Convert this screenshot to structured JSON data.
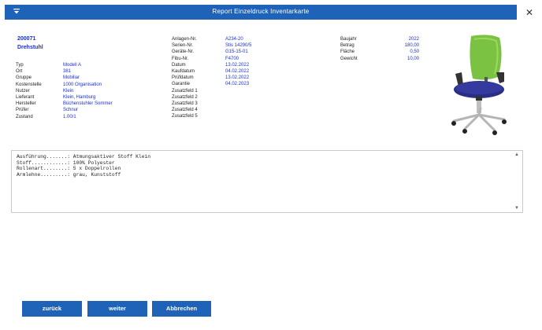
{
  "window": {
    "title": "Report Einzeldruck Inventarkarte",
    "menu_icon": "chevron-down-icon",
    "close_label": "✕"
  },
  "item": {
    "number": "200071",
    "name": "Drehstuhl"
  },
  "details_left": [
    {
      "label": "Typ",
      "value": "Modell A"
    },
    {
      "label": "Ort",
      "value": "381"
    },
    {
      "label": "Gruppe",
      "value": "Mobiliar"
    },
    {
      "label": "Kostenstelle",
      "value": "1000 Organisation"
    },
    {
      "label": "Nutzer",
      "value": "Klein"
    },
    {
      "label": "Lieferant",
      "value": "Klein, Hamburg"
    },
    {
      "label": "Hersteller",
      "value": "Büchenstuhler Sommer"
    },
    {
      "label": "Prüfer",
      "value": "Schnur"
    },
    {
      "label": "Zustand",
      "value": "1.00/1"
    }
  ],
  "details_middle": [
    {
      "label": "Anlagen-Nr.",
      "value": "A234-20"
    },
    {
      "label": "Serien-Nr.",
      "value": "Stis 14290/5"
    },
    {
      "label": "Geräte-Nr.",
      "value": "G15-15-01"
    },
    {
      "label": "Fibu-Nr.",
      "value": "F4700"
    },
    {
      "label": "Datum",
      "value": "13.02.2022"
    },
    {
      "label": "Kaufdatum",
      "value": "04.02.2022"
    },
    {
      "label": "Prüfdatum",
      "value": "13.02.2022"
    },
    {
      "label": "Garantie",
      "value": "04.02.2023"
    },
    {
      "label": "Zusatzfeld 1",
      "value": ""
    },
    {
      "label": "Zusatzfeld 2",
      "value": ""
    },
    {
      "label": "Zusatzfeld 3",
      "value": ""
    },
    {
      "label": "Zusatzfeld 4",
      "value": ""
    },
    {
      "label": "Zusatzfeld 5",
      "value": ""
    }
  ],
  "details_right": [
    {
      "label": "Baujahr",
      "value": "2022"
    },
    {
      "label": "Betrag",
      "value": "180,00"
    },
    {
      "label": "Fläche",
      "value": "0,50"
    },
    {
      "label": "Gewicht",
      "value": "10,00"
    }
  ],
  "notes": {
    "line1": "Ausführung.......: Atmungsaktiver Stoff Klein",
    "line2": "Stoff............: 100% Polyester",
    "line3": "Rollenart........: 5 x Doppelrollen",
    "line4": "Armlehne.........: grau, Kunststoff"
  },
  "buttons": {
    "back": "zurück",
    "next": "weiter",
    "cancel": "Abbrechen"
  },
  "colors": {
    "accent": "#1f63b8",
    "value_text": "#1a2fd0",
    "chair_back": "#7cc242",
    "chair_seat": "#2a2e86"
  }
}
